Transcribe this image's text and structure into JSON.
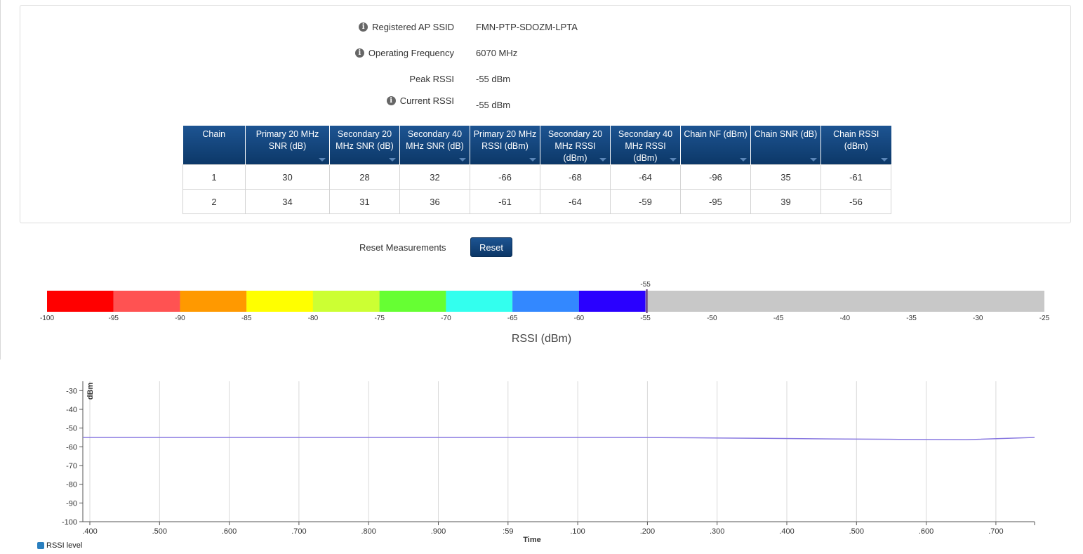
{
  "info": {
    "ssid": {
      "label": "Registered AP SSID",
      "value": "FMN-PTP-SDOZM-LPTA",
      "icon": "info-icon"
    },
    "frequency": {
      "label": "Operating Frequency",
      "value": "6070 MHz",
      "icon": "info-icon"
    },
    "peak_rssi": {
      "label": "Peak RSSI",
      "value": "-55 dBm"
    },
    "current_rssi": {
      "label": "Current RSSI",
      "value": "-55 dBm",
      "icon": "info-icon"
    }
  },
  "table": {
    "headers": [
      "Chain",
      "Primary 20 MHz SNR (dB)",
      "Secondary 20 MHz SNR (dB)",
      "Secondary 40 MHz SNR (dB)",
      "Primary 20 MHz RSSI (dBm)",
      "Secondary 20 MHz RSSI (dBm)",
      "Secondary 40 MHz RSSI (dBm)",
      "Chain NF (dBm)",
      "Chain SNR (dB)",
      "Chain RSSI (dBm)"
    ],
    "rows": [
      [
        "1",
        "30",
        "28",
        "32",
        "-66",
        "-68",
        "-64",
        "-96",
        "35",
        "-61"
      ],
      [
        "2",
        "34",
        "31",
        "36",
        "-61",
        "-64",
        "-59",
        "-95",
        "39",
        "-56"
      ]
    ]
  },
  "reset": {
    "label": "Reset Measurements",
    "button": "Reset"
  },
  "rssi_bar": {
    "title": "RSSI (dBm)",
    "min": -100,
    "max": -25,
    "current": -55,
    "current_label": "-55",
    "ticks": [
      "-100",
      "-95",
      "-90",
      "-85",
      "-80",
      "-75",
      "-70",
      "-65",
      "-60",
      "-55",
      "-50",
      "-45",
      "-40",
      "-35",
      "-30",
      "-25"
    ],
    "colors": [
      "#ff0000",
      "#ff5252",
      "#ff9900",
      "#ffff00",
      "#ccff33",
      "#66ff33",
      "#33ffee",
      "#3388ff",
      "#2a00ff"
    ],
    "inactive_color": "#c8c8c8"
  },
  "chart_data": {
    "type": "line",
    "ylabel": "dBm",
    "xlabel": "Time",
    "ylim": [
      -100,
      -25
    ],
    "y_ticks": [
      "-30",
      "-40",
      "-50",
      "-60",
      "-70",
      "-80",
      "-90",
      "-100"
    ],
    "x_ticks": [
      ".400",
      ".500",
      ".600",
      ".700",
      ".800",
      ".900",
      ":59",
      ".100",
      ".200",
      ".300",
      ".400",
      ".500",
      ".600",
      ".700"
    ],
    "grid": true,
    "legend": "bottom-left",
    "series": [
      {
        "name": "RSSI level",
        "color": "#8878e0",
        "values": [
          -55,
          -55,
          -55,
          -55,
          -55,
          -55,
          -55,
          -55,
          -55,
          -55.2,
          -55.5,
          -55.8,
          -56,
          -56.2,
          -55
        ]
      }
    ]
  }
}
